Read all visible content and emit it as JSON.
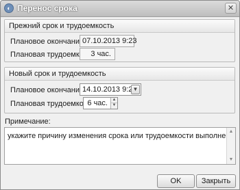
{
  "window": {
    "title": "Перенос срока"
  },
  "old_group": {
    "title": "Прежний срок и трудоемкость",
    "end_label": "Плановое окончание:",
    "end_value": "07.10.2013 9:23",
    "effort_label": "Плановая трудоемкость:",
    "effort_value": "3 час."
  },
  "new_group": {
    "title": "Новый срок и трудоемкость",
    "end_label": "Плановое окончание:",
    "end_value": "14.10.2013 9:23",
    "effort_label": "Плановая трудоемкость:",
    "effort_value": "6 час."
  },
  "note": {
    "label": "Примечание:",
    "text": "укажите причину изменения срока или трудоемкости выполнения поручения..."
  },
  "buttons": {
    "ok": "OK",
    "close": "Закрыть"
  }
}
